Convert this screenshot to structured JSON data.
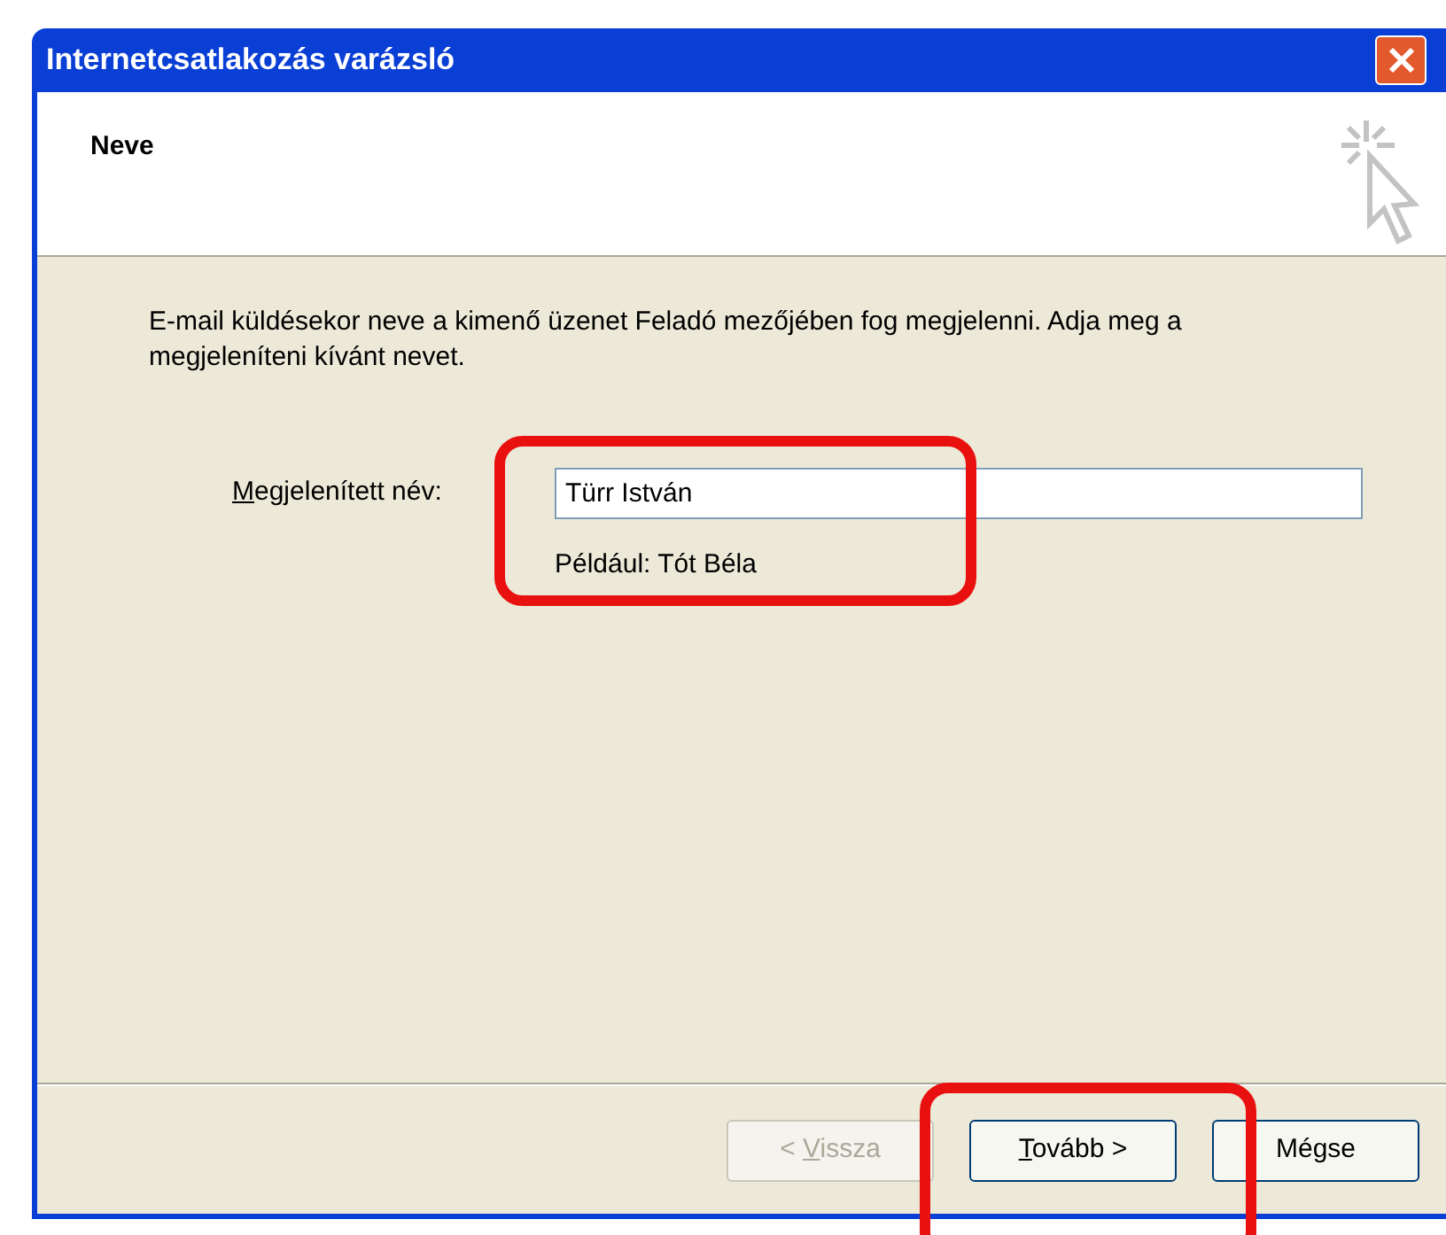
{
  "window": {
    "title": "Internetcsatlakozás varázsló"
  },
  "header": {
    "title": "Neve"
  },
  "description": "E-mail küldésekor neve a kimenő üzenet Feladó mezőjében fog megjelenni. Adja meg a megjeleníteni kívánt nevet.",
  "field": {
    "label": "Megjelenített név:",
    "access_key_underlined": true,
    "value": "Türr István",
    "example": "Például: Tót Béla"
  },
  "buttons": [
    {
      "label": "< Vissza",
      "disabled": true,
      "access_key_underlined": true
    },
    {
      "label": "Tovább >",
      "disabled": false,
      "access_key_underlined": true
    },
    {
      "label": "Mégse",
      "disabled": false,
      "access_key_underlined": false
    }
  ],
  "annotations": [
    {
      "color": "#e8110f"
    },
    {
      "color": "#e8110f"
    }
  ]
}
